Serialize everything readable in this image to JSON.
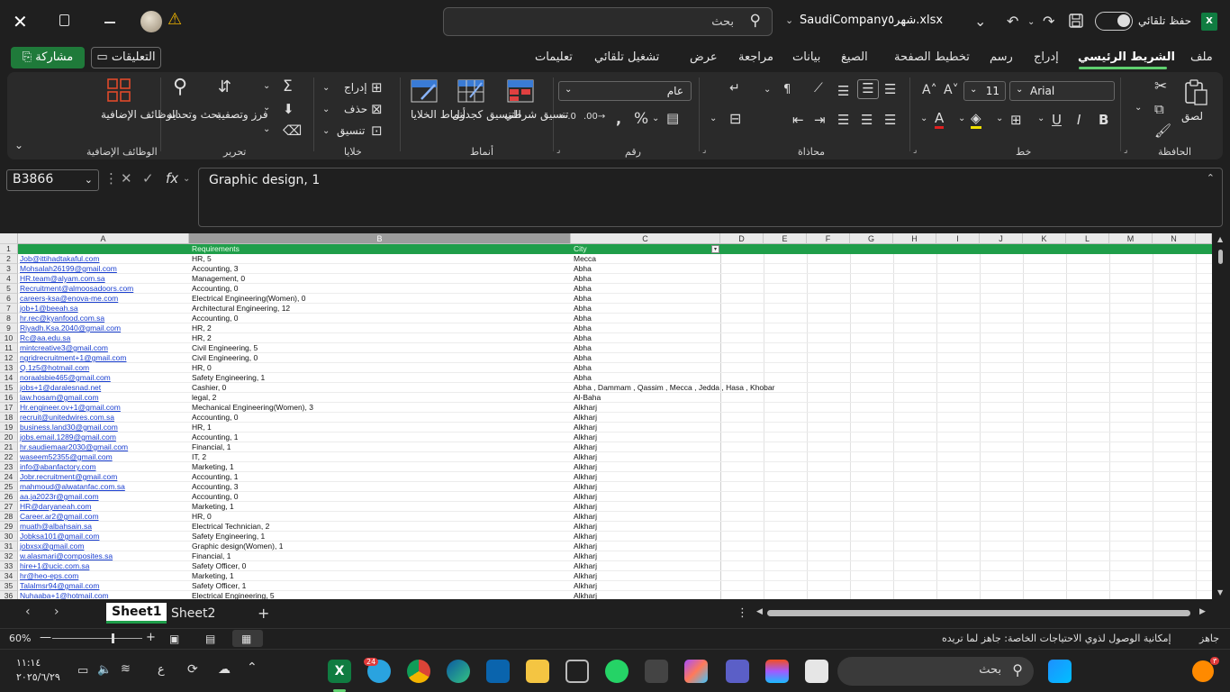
{
  "window": {
    "file_name": "SaudiCompanyشهر٥.xlsx",
    "search_placeholder": "بحث",
    "autosave_label": "حفظ تلقائي"
  },
  "menu": {
    "share_label": "مشاركة",
    "comments_label": "التعليقات",
    "tabs": [
      "ملف",
      "الشريط الرئيسي",
      "إدراج",
      "رسم",
      "تخطيط الصفحة",
      "الصيغ",
      "بيانات",
      "مراجعة",
      "عرض",
      "تشغيل تلقائي",
      "تعليمات"
    ],
    "active_tab": "الشريط الرئيسي"
  },
  "ribbon": {
    "clipboard": {
      "paste": "لصق",
      "group": "الحافظة"
    },
    "font": {
      "name": "Arial",
      "size": "11",
      "group": "خط"
    },
    "alignment": {
      "group": "محاذاة"
    },
    "number": {
      "format": "عام",
      "group": "رقم"
    },
    "styles": {
      "conditional": "تنسيق شرطي",
      "table": "التنسيق كجدول",
      "cell_styles": "أنماط الخلايا",
      "group": "أنماط"
    },
    "cells": {
      "insert": "إدراج",
      "delete": "حذف",
      "format": "تنسيق",
      "group": "خلايا"
    },
    "editing": {
      "sort_filter": "فرز وتصفية",
      "find_select": "بحث وتحديد",
      "group": "تحرير"
    },
    "addins": {
      "label": "الوظائف الإضافية",
      "group": "الوظائف الإضافية"
    }
  },
  "formula_bar": {
    "name_box": "B3866",
    "content": "Graphic design, 1"
  },
  "sheet": {
    "columns": [
      "A",
      "B",
      "C",
      "D",
      "E",
      "F",
      "G",
      "H",
      "I",
      "J",
      "K",
      "L",
      "M",
      "N"
    ],
    "selected_column": "B",
    "header": {
      "b": "Requirements",
      "c": "City"
    },
    "rows": [
      {
        "n": "2",
        "a": "Job@ittihadtakaful.com",
        "b": "HR, 5",
        "c": " Mecca"
      },
      {
        "n": "3",
        "a": "Mohsalah26199@gmail.com",
        "b": "Accounting, 3",
        "c": "Abha"
      },
      {
        "n": "4",
        "a": "HR.team@alyam.com.sa",
        "b": "Management, 0",
        "c": "Abha"
      },
      {
        "n": "5",
        "a": "Recruitment@almoosadoors.com",
        "b": "Accounting, 0",
        "c": "Abha"
      },
      {
        "n": "6",
        "a": "careers-ksa@enova-me.com",
        "b": "Electrical Engineering(Women), 0",
        "c": "Abha"
      },
      {
        "n": "7",
        "a": "job+1@beeah.sa",
        "b": "Architectural Engineering, 12",
        "c": "Abha"
      },
      {
        "n": "8",
        "a": "hr.rec@kyanfood.com.sa",
        "b": "Accounting, 0",
        "c": "Abha"
      },
      {
        "n": "9",
        "a": "Riyadh.Ksa.2040@gmail.com",
        "b": "HR, 2",
        "c": "Abha"
      },
      {
        "n": "10",
        "a": "Rc@aa.edu.sa",
        "b": "HR, 2",
        "c": "Abha"
      },
      {
        "n": "11",
        "a": "mintcreative3@gmail.com",
        "b": "Civil Engineering, 5",
        "c": "Abha"
      },
      {
        "n": "12",
        "a": "ngridrecruitment+1@gmail.com",
        "b": "Civil Engineering, 0",
        "c": "Abha"
      },
      {
        "n": "13",
        "a": "Q.1z5@hotmail.com",
        "b": "HR, 0",
        "c": "Abha"
      },
      {
        "n": "14",
        "a": "noraalsbie465@gmail.com",
        "b": "Safety Engineering, 1",
        "c": "Abha"
      },
      {
        "n": "15",
        "a": "jobs+1@daralesnad.net",
        "b": "Cashier, 0",
        "c": "Abha , Dammam  , Qassim  , Mecca  , Jedda  , Hasa  , Khobar"
      },
      {
        "n": "16",
        "a": "law.hosam@gmail.com",
        "b": "legal, 2",
        "c": "Al-Baha"
      },
      {
        "n": "17",
        "a": "Hr.engineer.ov+1@gmail.com",
        "b": "Mechanical Engineering(Women), 3",
        "c": "Alkharj"
      },
      {
        "n": "18",
        "a": "recruit@unitedwires.com.sa",
        "b": "Accounting, 0",
        "c": "Alkharj"
      },
      {
        "n": "19",
        "a": "business.land30@gmail.com",
        "b": "HR, 1",
        "c": "Alkharj"
      },
      {
        "n": "20",
        "a": "jobs.email.1289@gmail.com",
        "b": "Accounting, 1",
        "c": "Alkharj"
      },
      {
        "n": "21",
        "a": "hr.saudiemaar2030@gmail.com",
        "b": "Financial, 1",
        "c": "Alkharj"
      },
      {
        "n": "22",
        "a": "waseem52355@gmail.com",
        "b": "IT, 2",
        "c": "Alkharj"
      },
      {
        "n": "23",
        "a": "info@abanfactory.com",
        "b": "Marketing, 1",
        "c": "Alkharj"
      },
      {
        "n": "24",
        "a": "Jobr.recruitment@gmail.com",
        "b": "Accounting, 1",
        "c": "Alkharj"
      },
      {
        "n": "25",
        "a": "mahmoud@alwatanfac.com.sa",
        "b": "Accounting, 3",
        "c": "Alkharj"
      },
      {
        "n": "26",
        "a": "aa.ja2023r@gmail.com",
        "b": "Accounting, 0",
        "c": "Alkharj"
      },
      {
        "n": "27",
        "a": "HR@daryaneah.com",
        "b": "Marketing, 1",
        "c": "Alkharj"
      },
      {
        "n": "28",
        "a": "Career.ar2@gmail.com",
        "b": "HR, 0",
        "c": "Alkharj"
      },
      {
        "n": "29",
        "a": "muath@albahsain.sa",
        "b": "Electrical Technician, 2",
        "c": "Alkharj"
      },
      {
        "n": "30",
        "a": "Jobksa101@gmail.com",
        "b": "Safety Engineering, 1",
        "c": "Alkharj"
      },
      {
        "n": "31",
        "a": "jobxsx@gmail.com",
        "b": "Graphic design(Women), 1",
        "c": "Alkharj"
      },
      {
        "n": "32",
        "a": "w.alasmari@composites.sa",
        "b": "Financial, 1",
        "c": "Alkharj"
      },
      {
        "n": "33",
        "a": "hire+1@ucic.com.sa",
        "b": "Safety Officer, 0",
        "c": "Alkharj"
      },
      {
        "n": "34",
        "a": "hr@heo-eps.com",
        "b": "Marketing, 1",
        "c": "Alkharj"
      },
      {
        "n": "35",
        "a": "Talalmsr94@gmail.com",
        "b": "Safety Officer, 1",
        "c": "Alkharj"
      },
      {
        "n": "36",
        "a": "Nuhaaba+1@hotmail.com",
        "b": "Electrical Engineering, 5",
        "c": "Alkharj"
      }
    ]
  },
  "sheet_tabs": [
    "Sheet1",
    "Sheet2"
  ],
  "status": {
    "zoom": "60%",
    "ready": "جاهز",
    "accessibility": "إمكانية الوصول لذوي الاحتياجات الخاصة: جاهز لما تريده"
  },
  "taskbar": {
    "time": "١١:١٤",
    "date": "٢٠٢٥/٦/٢٩",
    "search_placeholder": "بحث",
    "lang": "ع",
    "telegram_badge": "24",
    "weather_badge": "٣"
  }
}
